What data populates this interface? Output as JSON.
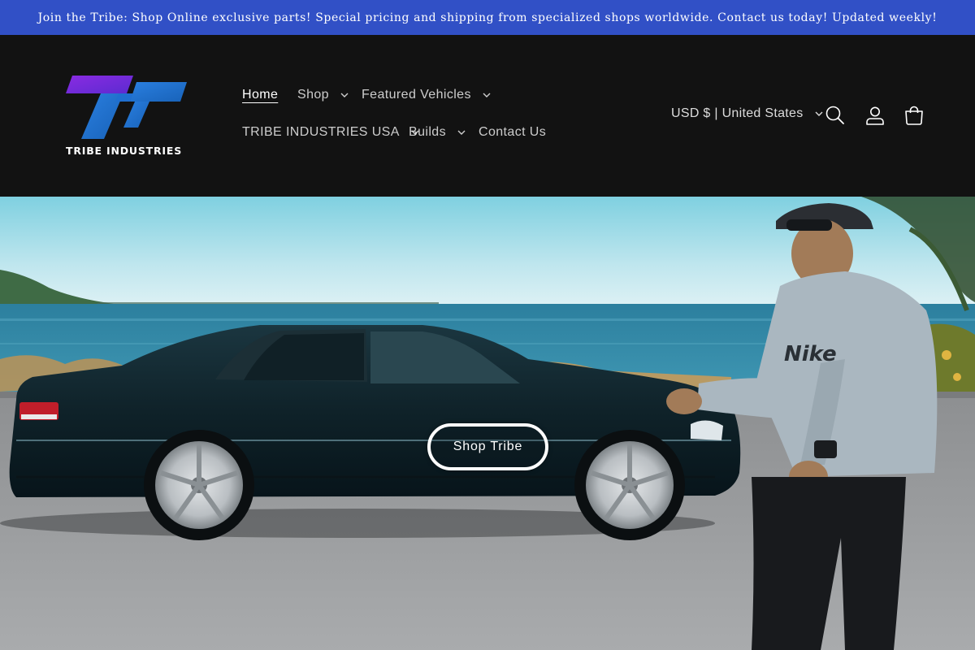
{
  "announcement": {
    "text": "Join the Tribe: Shop Online exclusive parts! Special pricing and shipping from specialized shops worldwide. Contact us today! Updated weekly!"
  },
  "logo": {
    "text": "TRIBE INDUSTRIES",
    "colors": {
      "purple": "#7a22c8",
      "blue": "#1f6fd0"
    }
  },
  "nav": {
    "items": [
      {
        "label": "Home",
        "active": true,
        "has_dropdown": false
      },
      {
        "label": "Shop",
        "has_dropdown": true
      },
      {
        "label": "Featured Vehicles",
        "has_dropdown": true
      },
      {
        "label": "TRIBE INDUSTRIES USA",
        "has_dropdown": true
      },
      {
        "label": "Builds",
        "has_dropdown": true
      },
      {
        "label": "Contact Us",
        "has_dropdown": false
      }
    ]
  },
  "header": {
    "country_selector": "USD $ | United States",
    "icons": [
      "search-icon",
      "account-icon",
      "cart-icon"
    ]
  },
  "hero": {
    "button_label": "Shop Tribe"
  },
  "colors": {
    "announcement_bg": "#3150c6",
    "header_bg": "#121212",
    "text": "#ffffff"
  }
}
